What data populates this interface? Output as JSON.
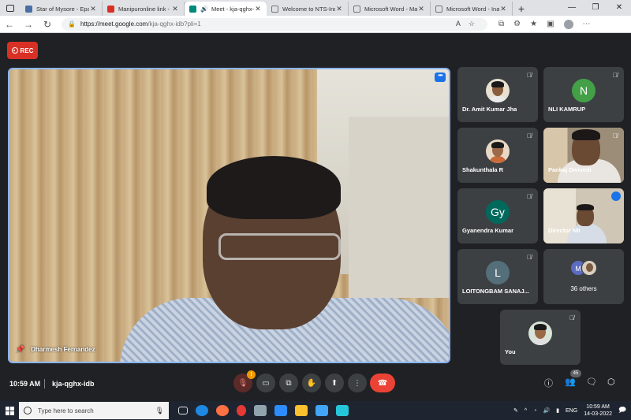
{
  "browser": {
    "tabs": [
      {
        "label": "Star of Mysore - Epaper",
        "color": "#4a6fa5"
      },
      {
        "label": "Manipuronline link - mu",
        "color": "#d93025"
      },
      {
        "label": "Meet - kja-qghx-idb",
        "color": "#00897b",
        "active": true
      },
      {
        "label": "Welcome to NTS-India W",
        "color": "#777777"
      },
      {
        "label": "Microsoft Word - Manip",
        "color": "#777777"
      },
      {
        "label": "Microsoft Word - Inaugu",
        "color": "#777777"
      }
    ],
    "url_host": "https://meet.google.com",
    "url_path": "/kja-qghx-idb?pli=1"
  },
  "meet": {
    "rec_label": "REC",
    "presenter_name": "Dharmesh Fernandez",
    "participants": [
      {
        "name": "Dr. Amit Kumar Jha",
        "type": "photo"
      },
      {
        "name": "NLI KAMRUP",
        "type": "letter",
        "letter": "N",
        "color": "#43a047"
      },
      {
        "name": "Shakunthala R",
        "type": "photo"
      },
      {
        "name": "Pankaj Dwivedi",
        "type": "video"
      },
      {
        "name": "Gyanendra Kumar",
        "type": "letter",
        "letter": "Gy",
        "color": "#00695c"
      },
      {
        "name": "Director NII",
        "type": "video"
      },
      {
        "name": "LOITONGBAM SANAJ...",
        "type": "letter",
        "letter": "L",
        "color": "#546e7a"
      },
      {
        "name": "You",
        "type": "photo"
      }
    ],
    "others_label": "36 others",
    "others_letter": "M",
    "time": "10:59 AM",
    "meeting_code": "kja-qghx-idb",
    "warning_badge": "!",
    "people_count": "45"
  },
  "taskbar": {
    "search_placeholder": "Type here to search",
    "language": "ENG",
    "time": "10:59 AM",
    "date": "14-03-2022"
  }
}
